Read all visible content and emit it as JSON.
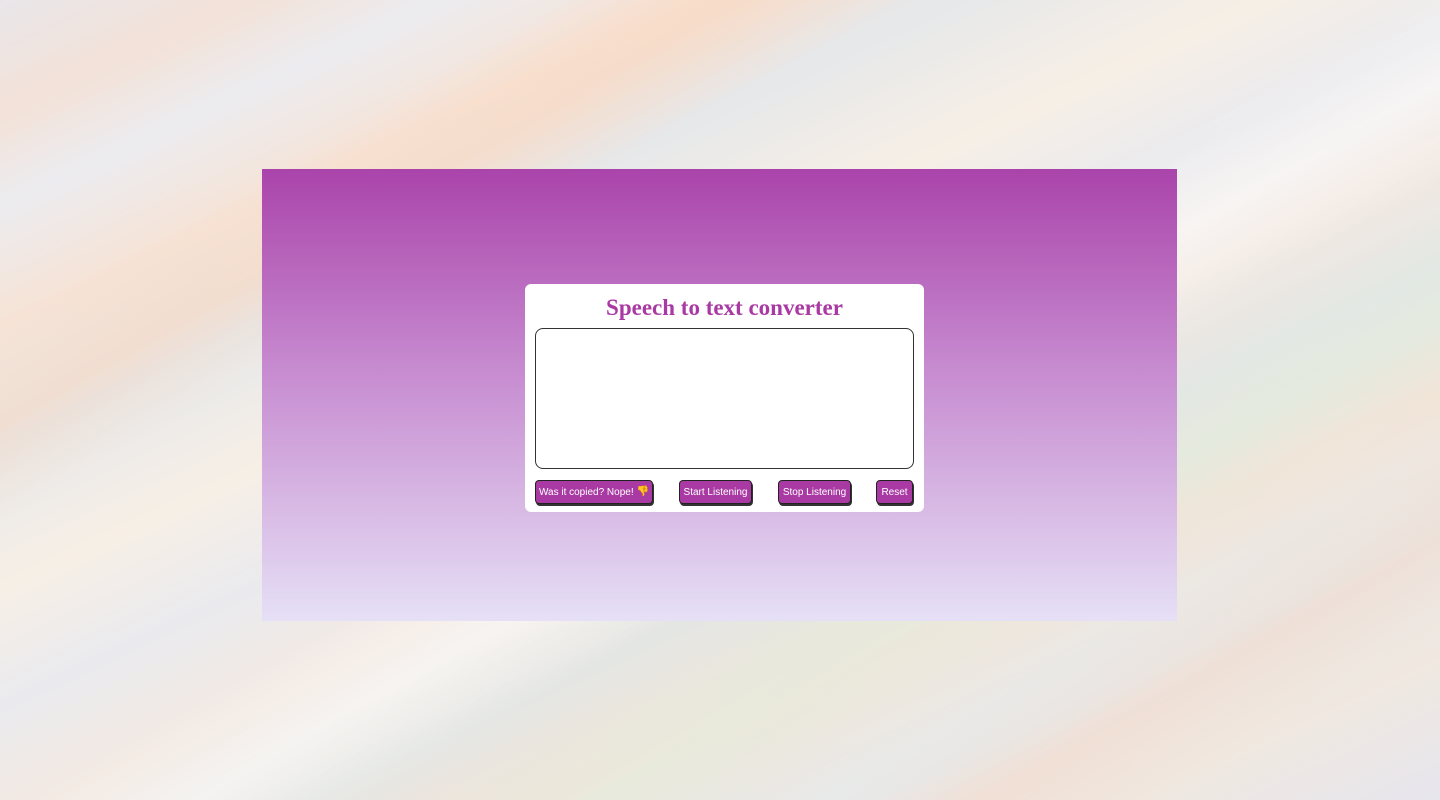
{
  "app": {
    "title": "Speech to text converter"
  },
  "transcript": {
    "value": "",
    "placeholder": ""
  },
  "buttons": {
    "copy_label": "Was it copied? Nope!",
    "copy_icon": "👎",
    "start_label": "Start Listening",
    "stop_label": "Stop Listening",
    "reset_label": "Reset"
  },
  "colors": {
    "accent": "#a93aa3",
    "gradient_top": "#aa44ab",
    "gradient_bottom": "#e6e0f6"
  }
}
